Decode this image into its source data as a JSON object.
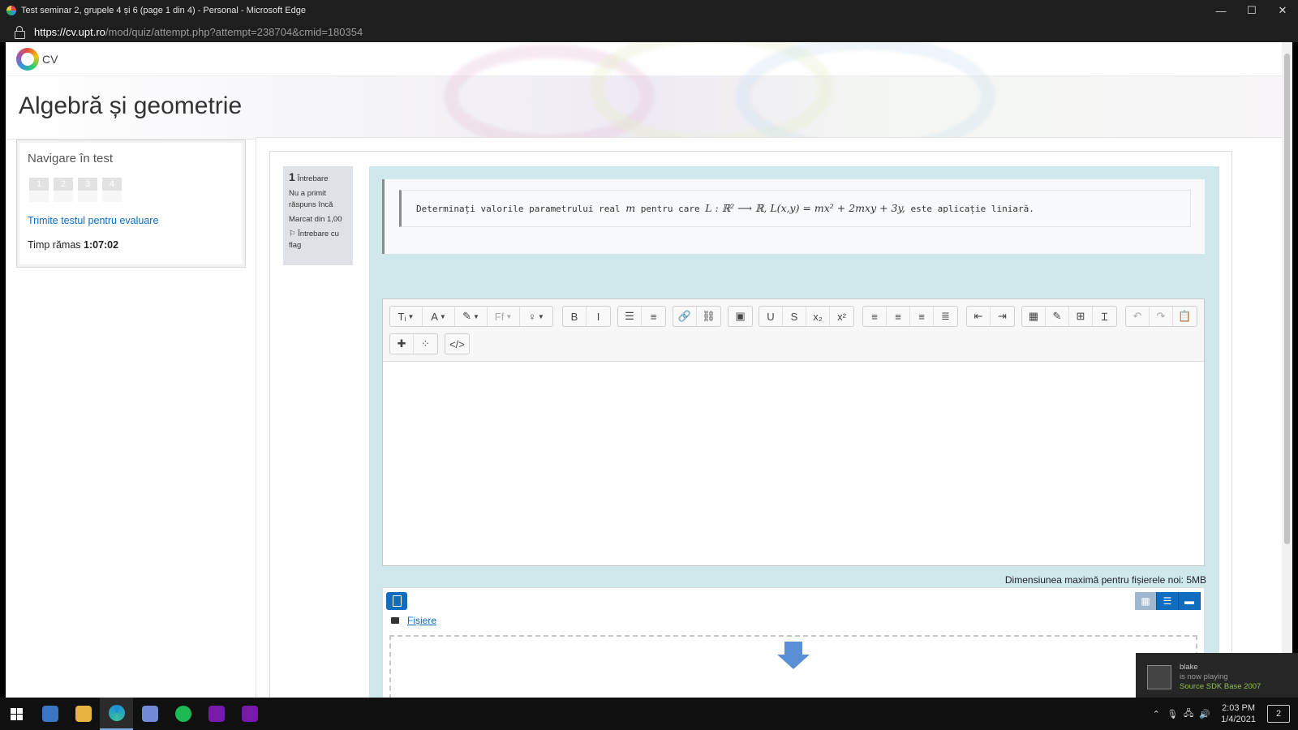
{
  "window": {
    "title": "Test seminar 2, grupele 4 și 6 (page 1 din 4) - Personal - Microsoft Edge",
    "url_host": "https://cv.upt.ro",
    "url_path": "/mod/quiz/attempt.php?attempt=238704&cmid=180354"
  },
  "site": {
    "name": "CV"
  },
  "course": {
    "title": "Algebră și geometrie"
  },
  "quiz_nav": {
    "heading": "Navigare în test",
    "questions": [
      "1",
      "2",
      "3",
      "4"
    ],
    "submit_link": "Trimite testul pentru evaluare",
    "time_label": "Timp rămas",
    "time_value": "1:07:02"
  },
  "question_info": {
    "number": "1",
    "word": "Întrebare",
    "state": "Nu a primit răspuns încă",
    "grade": "Marcat din 1,00",
    "flag": "Întrebare cu flag"
  },
  "question": {
    "text_before": "Determinați valorile parametrului real",
    "param": "m",
    "text_mid": "pentru care",
    "formula": "L : ℝ² ⟶ ℝ,  L(x,y) = mx² + 2mxy + 3y,",
    "text_after": "este aplicație liniară."
  },
  "editor_toolbar": {
    "row1": [
      [
        "paragraph-style-icon",
        "font-color-icon",
        "highlight-icon",
        "font-family-icon",
        "lightbulb-icon"
      ],
      [
        "bold-icon",
        "italic-icon"
      ],
      [
        "unordered-list-icon",
        "ordered-list-icon"
      ],
      [
        "link-icon",
        "unlink-icon"
      ],
      [
        "image-icon"
      ],
      [
        "underline-icon",
        "strikethrough-icon",
        "subscript-icon",
        "superscript-icon"
      ],
      [
        "align-left-icon",
        "align-center-icon",
        "align-right-icon",
        "align-justify-icon"
      ],
      [
        "outdent-icon",
        "indent-icon"
      ],
      [
        "equation-icon",
        "edit-icon",
        "table-icon",
        "clear-format-icon"
      ],
      [
        "undo-icon",
        "redo-icon",
        "paste-icon"
      ]
    ],
    "row2": [
      [
        "accessibility-icon",
        "screenreader-icon"
      ],
      [
        "html-source-icon"
      ]
    ],
    "glyphs": {
      "paragraph-style-icon": "Tᵢ",
      "font-color-icon": "A",
      "highlight-icon": "✎",
      "font-family-icon": "Ff",
      "lightbulb-icon": "♀",
      "bold-icon": "B",
      "italic-icon": "I",
      "unordered-list-icon": "☰",
      "ordered-list-icon": "≡",
      "link-icon": "🔗",
      "unlink-icon": "⛓",
      "image-icon": "▣",
      "underline-icon": "U",
      "strikethrough-icon": "S",
      "subscript-icon": "x₂",
      "superscript-icon": "x²",
      "align-left-icon": "≡",
      "align-center-icon": "≡",
      "align-right-icon": "≡",
      "align-justify-icon": "≣",
      "outdent-icon": "⇤",
      "indent-icon": "⇥",
      "equation-icon": "▦",
      "edit-icon": "✎",
      "table-icon": "⊞",
      "clear-format-icon": "Ɪ",
      "undo-icon": "↶",
      "redo-icon": "↷",
      "paste-icon": "📋",
      "accessibility-icon": "✚",
      "screenreader-icon": "⁘",
      "html-source-icon": "</>"
    }
  },
  "file_upload": {
    "max_size_note": "Dimensiunea maximă pentru fișierele noi: 5MB",
    "folder_label": "Fișiere"
  },
  "notification": {
    "user": "blake",
    "status": "is now playing",
    "game": "Source SDK Base 2007"
  },
  "taskbar": {
    "time": "2:03 PM",
    "date": "1/4/2021",
    "notif_count": "2"
  }
}
